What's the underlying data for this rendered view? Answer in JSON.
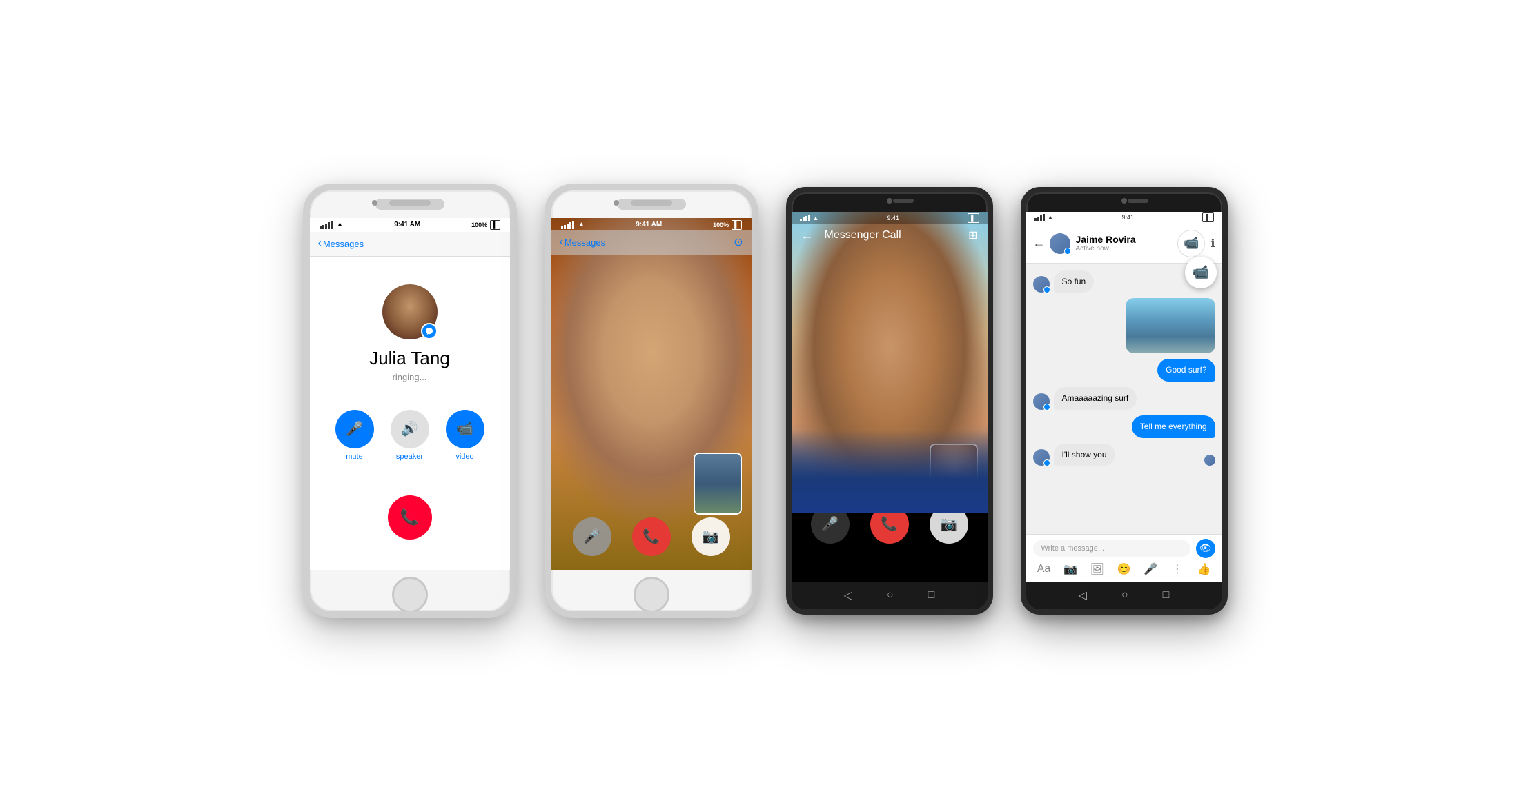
{
  "phones": [
    {
      "id": "phone1",
      "type": "iphone",
      "screen": "call",
      "statusBar": {
        "carrier": "•••••",
        "wifi": "WiFi",
        "time": "9:41 AM",
        "battery": "100%"
      },
      "nav": {
        "backLabel": "Messages"
      },
      "call": {
        "contactName": "Julia Tang",
        "status": "ringing...",
        "controls": [
          {
            "id": "mute",
            "label": "mute",
            "icon": "🎤"
          },
          {
            "id": "speaker",
            "label": "speaker",
            "icon": "🔊"
          },
          {
            "id": "video",
            "label": "video",
            "icon": "📹"
          }
        ]
      }
    },
    {
      "id": "phone2",
      "type": "iphone",
      "screen": "video-call-ios",
      "statusBar": {
        "carrier": "•••••",
        "wifi": "WiFi",
        "time": "9:41 AM",
        "battery": "100%"
      },
      "nav": {
        "backLabel": "Messages"
      }
    },
    {
      "id": "phone3",
      "type": "android",
      "screen": "video-call-android",
      "statusBar": {
        "time": "9:41"
      },
      "call": {
        "title": "Messenger Call"
      }
    },
    {
      "id": "phone4",
      "type": "android",
      "screen": "chat",
      "statusBar": {
        "time": "9:41"
      },
      "chat": {
        "contactName": "Jaime Rovira",
        "activeStatus": "Active now",
        "messages": [
          {
            "type": "received",
            "text": "So fun"
          },
          {
            "type": "image",
            "sent": true
          },
          {
            "type": "sent",
            "text": "Good surf?"
          },
          {
            "type": "received",
            "text": "Amaaaaazing surf"
          },
          {
            "type": "sent",
            "text": "Tell me everything"
          },
          {
            "type": "received",
            "text": "I'll show you"
          }
        ],
        "inputPlaceholder": "Write a message..."
      }
    }
  ]
}
